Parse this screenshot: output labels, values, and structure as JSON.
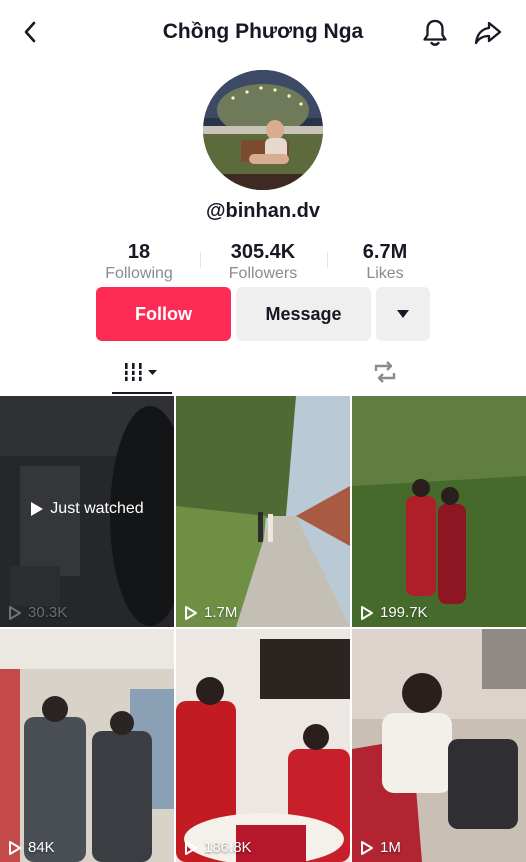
{
  "header": {
    "title": "Chồng Phương Nga"
  },
  "profile": {
    "username": "@binhan.dv",
    "stats": [
      {
        "value": "18",
        "label": "Following"
      },
      {
        "value": "305.4K",
        "label": "Followers"
      },
      {
        "value": "6.7M",
        "label": "Likes"
      }
    ]
  },
  "actions": {
    "follow_label": "Follow",
    "message_label": "Message"
  },
  "colors": {
    "accent": "#fe2c55",
    "button_gray": "#efeff0"
  },
  "videos": [
    {
      "views": "30.3K",
      "overlay": "Just watched"
    },
    {
      "views": "1.7M"
    },
    {
      "views": "199.7K"
    },
    {
      "views": "84K"
    },
    {
      "views": "186.8K"
    },
    {
      "views": "1M"
    }
  ]
}
